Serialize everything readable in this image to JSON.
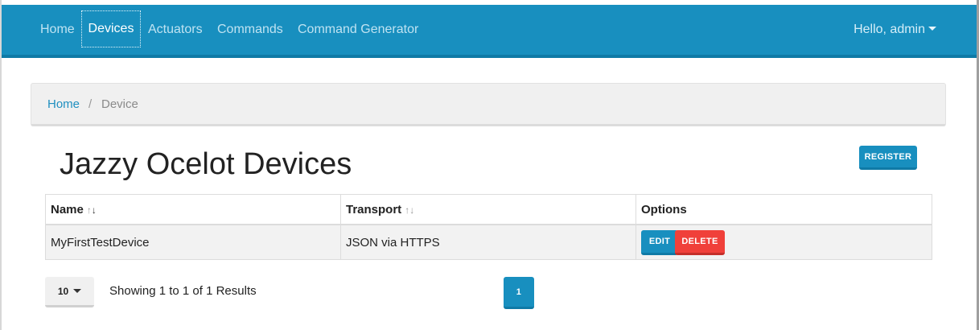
{
  "navbar": {
    "items": [
      {
        "label": "Home"
      },
      {
        "label": "Devices",
        "active": true
      },
      {
        "label": "Actuators"
      },
      {
        "label": "Commands"
      },
      {
        "label": "Command Generator"
      }
    ],
    "user_label": "Hello, admin"
  },
  "breadcrumb": {
    "home": "Home",
    "separator": "/",
    "current": "Device"
  },
  "page": {
    "title": "Jazzy Ocelot Devices",
    "register_label": "REGISTER"
  },
  "table": {
    "headers": {
      "name": "Name",
      "transport": "Transport",
      "options": "Options"
    },
    "sort_up": "↑",
    "sort_down": "↓",
    "rows": [
      {
        "name": "MyFirstTestDevice",
        "transport": "JSON via HTTPS",
        "edit_label": "EDIT",
        "delete_label": "DELETE"
      }
    ]
  },
  "footer": {
    "page_size": "10",
    "results_text": "Showing 1 to 1 of 1 Results",
    "current_page": "1"
  },
  "colors": {
    "primary": "#188fbf",
    "danger": "#f0403a"
  }
}
